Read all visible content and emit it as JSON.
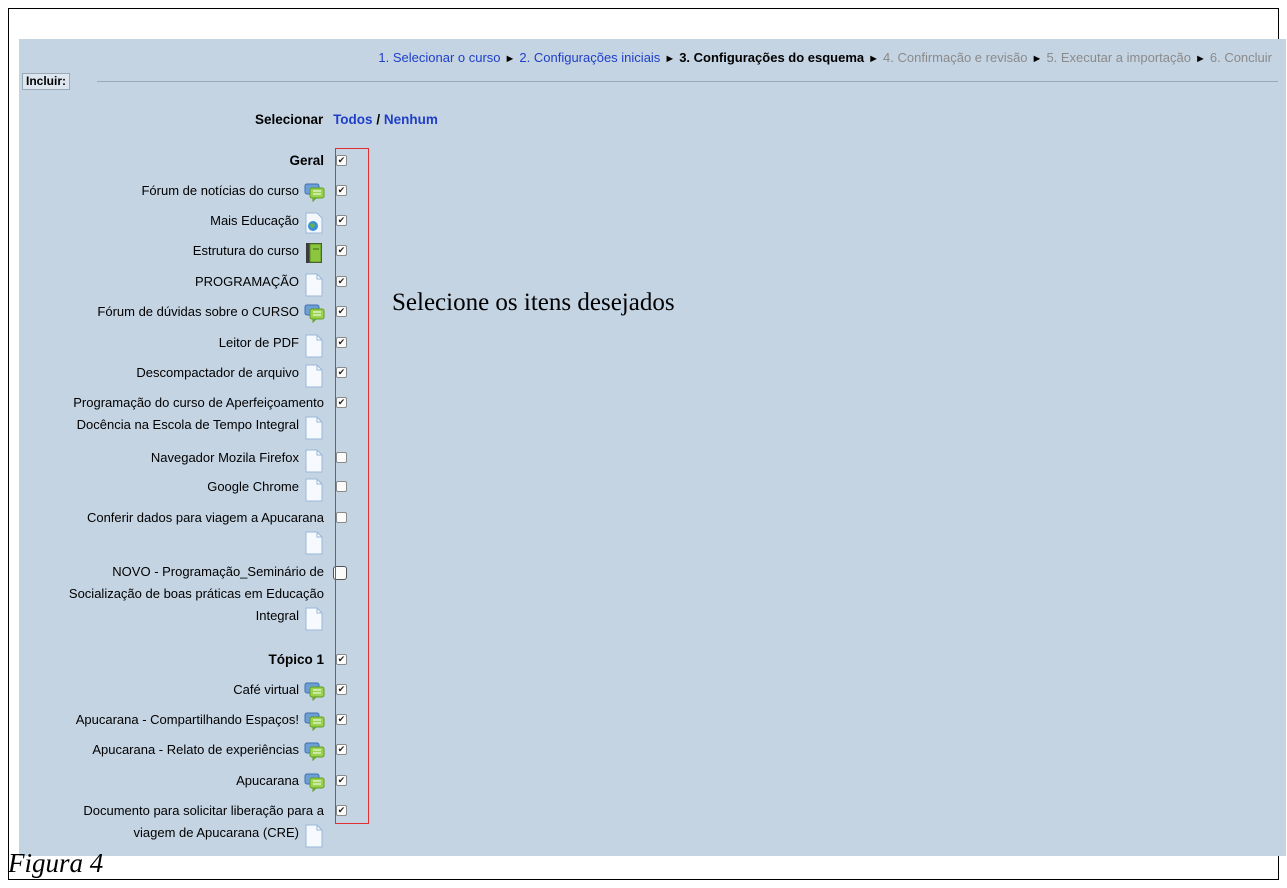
{
  "breadcrumb": {
    "step1": "1. Selecionar o curso",
    "step2": "2. Configurações iniciais",
    "step3": "3. Configurações do esquema",
    "step4": "4. Confirmação e revisão",
    "step5": "5. Executar a importação",
    "step6": "6. Concluir",
    "separator": "►"
  },
  "include_label": "Incluir:",
  "select": {
    "label": "Selecionar",
    "all": "Todos",
    "slash": " / ",
    "none": "Nenhum"
  },
  "items": [
    {
      "label": "Geral",
      "icon": "none",
      "checked": true,
      "section": true
    },
    {
      "label": "Fórum de notícias do curso",
      "icon": "forum-icon",
      "checked": true
    },
    {
      "label": "Mais Educação",
      "icon": "url-icon",
      "checked": true
    },
    {
      "label": "Estrutura do curso",
      "icon": "book-icon",
      "checked": true
    },
    {
      "label": "PROGRAMAÇÃO",
      "icon": "file-icon",
      "checked": true
    },
    {
      "label": "Fórum de dúvidas sobre o CURSO",
      "icon": "forum-icon",
      "checked": true
    },
    {
      "label": "Leitor de PDF",
      "icon": "file-icon",
      "checked": true
    },
    {
      "label": "Descompactador de arquivo",
      "icon": "file-icon",
      "checked": true
    },
    {
      "label": "Programação do curso de Aperfeiçoamento",
      "label2": "Docência na Escola de Tempo Integral",
      "icon": "file-icon",
      "checked": true
    },
    {
      "label": "Navegador Mozila Firefox",
      "icon": "file-icon",
      "checked": false
    },
    {
      "label": "Google Chrome",
      "icon": "file-icon",
      "checked": false
    },
    {
      "label": "Conferir dados para viagem a Apucarana",
      "icon": "file-icon",
      "checked": false
    },
    {
      "label": "NOVO - Programação_Seminário de",
      "label2": "Socialização de boas práticas em Educação",
      "label3": "Integral",
      "icon": "file-icon",
      "checked": false
    },
    {
      "label": "Tópico 1",
      "icon": "none",
      "checked": true,
      "section": true
    },
    {
      "label": "Café virtual",
      "icon": "forum-icon",
      "checked": true
    },
    {
      "label": "Apucarana - Compartilhando Espaços!",
      "icon": "forum-icon",
      "checked": true
    },
    {
      "label": "Apucarana - Relato de experiências",
      "icon": "forum-icon",
      "checked": true
    },
    {
      "label": "Apucarana",
      "icon": "forum-icon",
      "checked": true
    },
    {
      "label": "Documento para solicitar liberação para a",
      "label2": "viagem de Apucarana (CRE)",
      "icon": "file-icon",
      "checked": true
    }
  ],
  "annotation": "Selecione os itens desejados",
  "caption": "Figura 4",
  "colors": {
    "background": "#c5d4e3",
    "link": "#1e3fc8",
    "highlight_box": "#e03030"
  }
}
